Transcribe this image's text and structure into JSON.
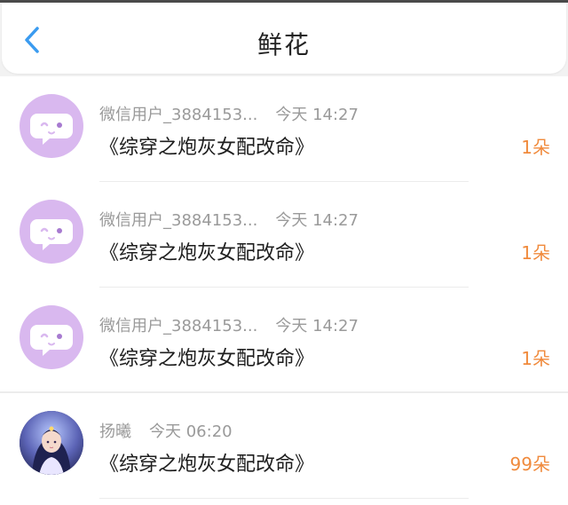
{
  "header": {
    "title": "鲜花",
    "back_icon": "chevron-left-icon",
    "accent_color": "#3a9bf0"
  },
  "items": [
    {
      "user": "微信用户_3884153...",
      "time": "今天 14:27",
      "book": "《综穿之炮灰女配改命》",
      "count": "1朵",
      "avatar": "wink-chat-bubble-avatar"
    },
    {
      "user": "微信用户_3884153...",
      "time": "今天 14:27",
      "book": "《综穿之炮灰女配改命》",
      "count": "1朵",
      "avatar": "wink-chat-bubble-avatar"
    },
    {
      "user": "微信用户_3884153...",
      "time": "今天 14:27",
      "book": "《综穿之炮灰女配改命》",
      "count": "1朵",
      "avatar": "wink-chat-bubble-avatar"
    },
    {
      "user": "扬曦",
      "time": "今天 06:20",
      "book": "《综穿之炮灰女配改命》",
      "count": "99朵",
      "avatar": "anime-portrait-avatar"
    }
  ],
  "colors": {
    "count": "#f08a3c",
    "avatar_bg": "#d9b8ef"
  }
}
